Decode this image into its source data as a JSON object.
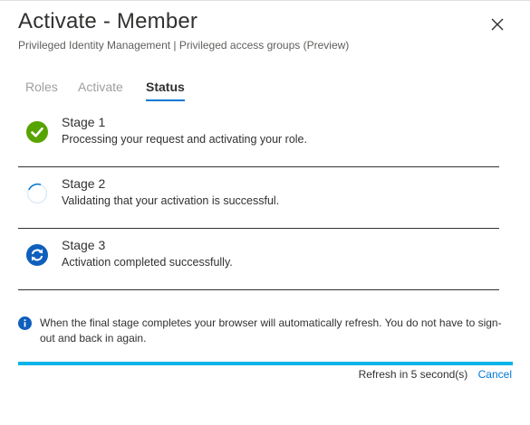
{
  "header": {
    "title": "Activate - Member",
    "subtitle": "Privileged Identity Management | Privileged access groups (Preview)",
    "close_icon": "close-icon"
  },
  "tabs": [
    {
      "label": "Roles",
      "active": false
    },
    {
      "label": "Activate",
      "active": false
    },
    {
      "label": "Status",
      "active": true
    }
  ],
  "stages": [
    {
      "title": "Stage 1",
      "description": "Processing your request and activating your role.",
      "state": "completed",
      "icon": "check-circle-icon"
    },
    {
      "title": "Stage 2",
      "description": "Validating that your activation is successful.",
      "state": "in-progress",
      "icon": "spinner-icon"
    },
    {
      "title": "Stage 3",
      "description": "Activation completed successfully.",
      "state": "pending",
      "icon": "refresh-circle-icon"
    }
  ],
  "info": {
    "icon": "info-icon",
    "text": "When the final stage completes your browser will automatically refresh. You do not have to sign-out and back in again."
  },
  "progress": {
    "fraction": 1.0
  },
  "footer": {
    "refresh_text": "Refresh in 5 second(s)",
    "cancel_label": "Cancel"
  },
  "colors": {
    "accent": "#0078d4",
    "progress": "#0bb4e8",
    "success": "#57a300"
  }
}
